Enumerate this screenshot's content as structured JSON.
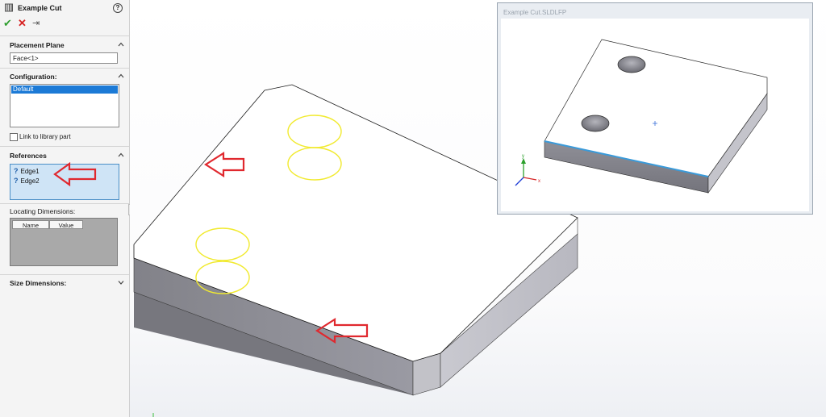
{
  "panel": {
    "title": "Example Cut",
    "help_glyph": "?",
    "ok_glyph": "✔",
    "cancel_glyph": "✕",
    "pin_glyph": "⇥",
    "placement_plane": {
      "header": "Placement Plane",
      "value": "Face<1>"
    },
    "configuration": {
      "header": "Configuration:",
      "selected": "Default"
    },
    "link_label": "Link to library part",
    "references": {
      "header": "References",
      "items": [
        "Edge1",
        "Edge2"
      ],
      "item_glyph": "?"
    },
    "locating": {
      "header": "Locating Dimensions:",
      "col_name": "Name",
      "col_value": "Value"
    },
    "size_header": "Size Dimensions:"
  },
  "preview": {
    "window_title": "Example Cut.SLDLFP"
  },
  "colors": {
    "highlight": "#1c7ad6",
    "circle": "#f1ea2f",
    "arrow": "#e0282e",
    "edge": "#3a9ad9"
  }
}
